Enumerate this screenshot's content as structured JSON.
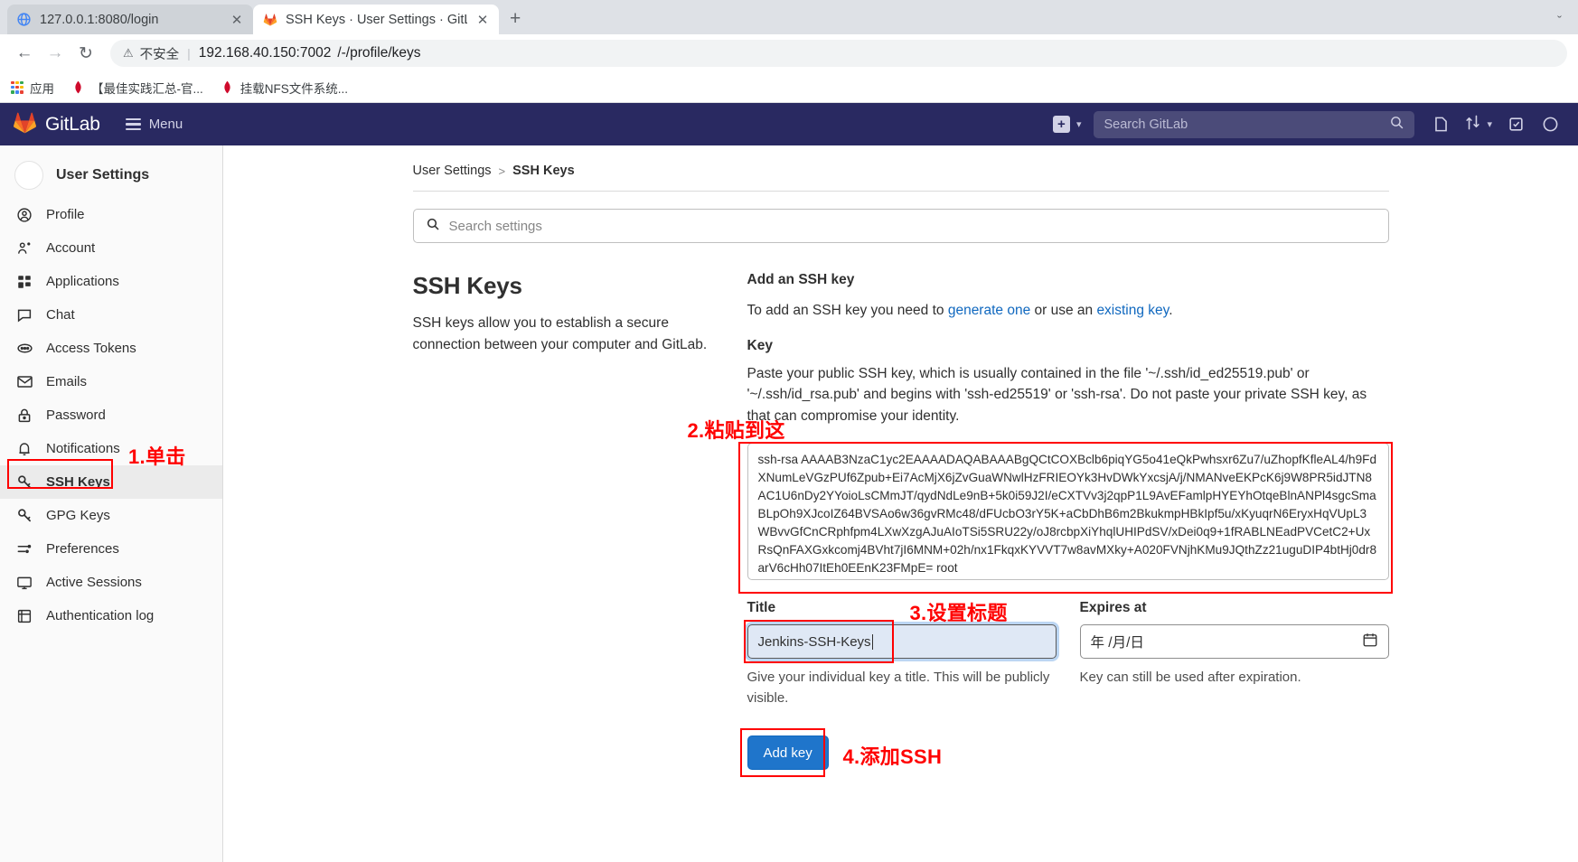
{
  "browser": {
    "tabs": [
      {
        "title": "127.0.0.1:8080/login",
        "favicon": "globe-icon",
        "active": false
      },
      {
        "title": "SSH Keys · User Settings · GitLa",
        "favicon": "gitlab-icon",
        "active": true
      }
    ],
    "new_tab_label": "+",
    "minimize_label": "ˇ",
    "toolbar": {
      "back": "←",
      "forward": "→",
      "reload": "↻",
      "warning_icon": "⚠",
      "security_text": "不安全",
      "url_host": "192.168.40.150:7002",
      "url_path": "/-/profile/keys"
    },
    "bookmarks": [
      {
        "label": "应用",
        "icon": "apps-grid-icon"
      },
      {
        "label": "【最佳实践汇总-官...",
        "icon": "huawei-icon"
      },
      {
        "label": "挂载NFS文件系统...",
        "icon": "huawei-icon"
      }
    ]
  },
  "navbar": {
    "brand": "GitLab",
    "menu_label": "Menu",
    "plus_label": "+",
    "chevron": "⌄",
    "search_placeholder": "Search GitLab",
    "icons": [
      "search-icon",
      "issues-icon",
      "merge-requests-icon",
      "todos-icon",
      "avatar-icon"
    ]
  },
  "sidebar": {
    "title": "User Settings",
    "items": [
      {
        "label": "Profile",
        "icon": "user-circle-icon",
        "active": false
      },
      {
        "label": "Account",
        "icon": "account-gear-icon",
        "active": false
      },
      {
        "label": "Applications",
        "icon": "applications-grid-icon",
        "active": false
      },
      {
        "label": "Chat",
        "icon": "chat-bubble-icon",
        "active": false
      },
      {
        "label": "Access Tokens",
        "icon": "token-icon",
        "active": false
      },
      {
        "label": "Emails",
        "icon": "envelope-icon",
        "active": false
      },
      {
        "label": "Password",
        "icon": "lock-icon",
        "active": false
      },
      {
        "label": "Notifications",
        "icon": "bell-icon",
        "active": false
      },
      {
        "label": "SSH Keys",
        "icon": "key-icon",
        "active": true
      },
      {
        "label": "GPG Keys",
        "icon": "key-icon",
        "active": false
      },
      {
        "label": "Preferences",
        "icon": "sliders-icon",
        "active": false
      },
      {
        "label": "Active Sessions",
        "icon": "monitor-icon",
        "active": false
      },
      {
        "label": "Authentication log",
        "icon": "log-icon",
        "active": false
      }
    ]
  },
  "breadcrumb": {
    "parent": "User Settings",
    "separator": ">",
    "current": "SSH Keys"
  },
  "settings_search": {
    "placeholder": "Search settings",
    "icon": "search-icon"
  },
  "left_panel": {
    "title": "SSH Keys",
    "description": "SSH keys allow you to establish a secure connection between your computer and GitLab."
  },
  "form": {
    "heading": "Add an SSH key",
    "intro_before": "To add an SSH key you need to ",
    "intro_link1": "generate one",
    "intro_middle": " or use an ",
    "intro_link2": "existing key",
    "intro_after": ".",
    "key_label": "Key",
    "key_help": "Paste your public SSH key, which is usually contained in the file '~/.ssh/id_ed25519.pub' or '~/.ssh/id_rsa.pub' and begins with 'ssh-ed25519' or 'ssh-rsa'. Do not paste your private SSH key, as that can compromise your identity.",
    "key_value": "ssh-rsa AAAAB3NzaC1yc2EAAAADAQABAAABgQCtCOXBclb6piqYG5o41eQkPwhsxr6Zu7/uZhopfKfleAL4/h9FdXNumLeVGzPUf6Zpub+Ei7AcMjX6jZvGuaWNwlHzFRIEOYk3HvDWkYxcsjA/j/NMANveEKPcK6j9W8PR5idJTN8AC1U6nDy2YYoioLsCMmJT/qydNdLe9nB+5k0i59J2I/eCXTVv3j2qpP1L9AvEFamlpHYEYhOtqeBlnANPl4sgcSmaBLpOh9XJcoIZ64BVSAo6w36gvRMc48/dFUcbO3rY5K+aCbDhB6m2BkukmpHBkIpf5u/xKyuqrN6EryxHqVUpL3WBvvGfCnCRphfpm4LXwXzgAJuAIoTSi5SRU22y/oJ8rcbpXiYhqlUHIPdSV/xDei0q9+1fRABLNEadPVCetC2+UxRsQnFAXGxkcomj4BVht7jI6MNM+02h/nx1FkqxKYVVT7w8avMXky+A020FVNjhKMu9JQthZz21uguDIP4btHj0dr8arV6cHh07ItEh0EEnK23FMpE= root",
    "title_label": "Title",
    "title_value": "Jenkins-SSH-Keys",
    "title_hint": "Give your individual key a title. This will be publicly visible.",
    "expires_label": "Expires at",
    "expires_placeholder": "年 /月/日",
    "expires_hint": "Key can still be used after expiration.",
    "submit_label": "Add key"
  },
  "annotations": [
    {
      "id": "step1",
      "text": "1.单击"
    },
    {
      "id": "step2",
      "text": "2.粘贴到这"
    },
    {
      "id": "step3",
      "text": "3.设置标题"
    },
    {
      "id": "step4",
      "text": "4.添加SSH"
    }
  ],
  "colors": {
    "gitlab_navy": "#292961",
    "accent_blue": "#1f75cb",
    "link_blue": "#1068bf",
    "annotation_red": "#ff0000"
  }
}
